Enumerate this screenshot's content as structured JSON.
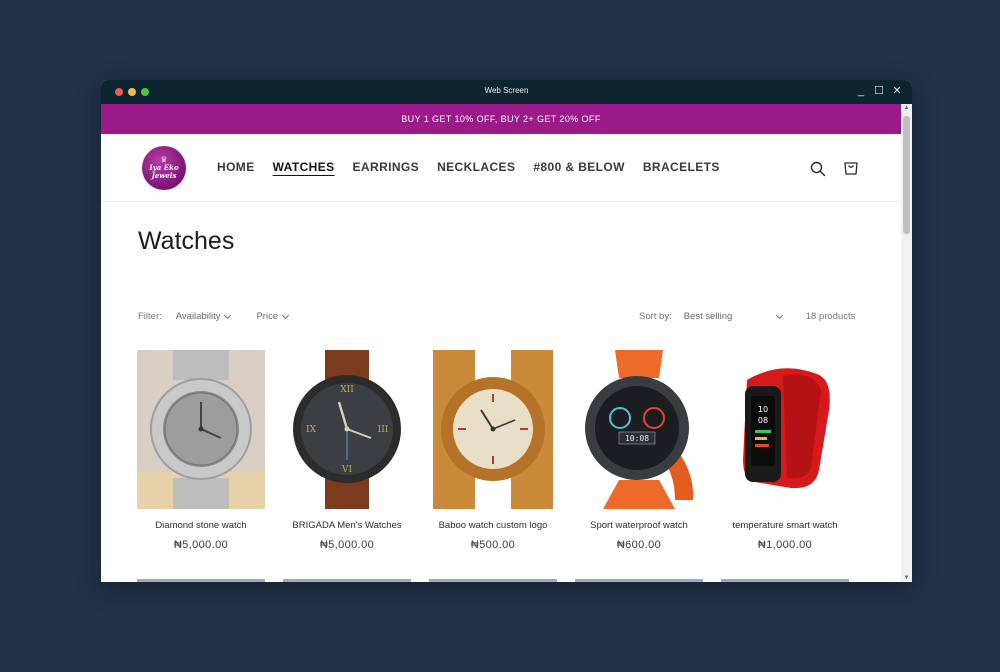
{
  "window": {
    "title": "Web Screen"
  },
  "announcement": {
    "text": "BUY 1 GET 10% OFF, BUY 2+ GET 20% OFF"
  },
  "brand": {
    "logo_text_line1": "Iya Eko",
    "logo_text_line2": "Jewels"
  },
  "nav": {
    "items": [
      {
        "label": "HOME"
      },
      {
        "label": "WATCHES"
      },
      {
        "label": "EARRINGS"
      },
      {
        "label": "NECKLACES"
      },
      {
        "label": "#800 & BELOW"
      },
      {
        "label": "BRACELETS"
      }
    ]
  },
  "collection": {
    "title": "Watches"
  },
  "filters": {
    "label": "Filter:",
    "availability": "Availability",
    "price": "Price"
  },
  "sort": {
    "label": "Sort by:",
    "selected": "Best selling",
    "count": "18 products"
  },
  "products": [
    {
      "title": "Diamond stone watch",
      "price": "₦5,000.00"
    },
    {
      "title": "BRIGADA Men's Watches",
      "price": "₦5,000.00"
    },
    {
      "title": "Baboo watch custom logo",
      "price": "₦500.00"
    },
    {
      "title": "Sport waterproof watch",
      "price": "₦600.00"
    },
    {
      "title": "temperature smart watch",
      "price": "₦1,000.00"
    }
  ],
  "colors": {
    "announcement_bg": "#9b1a8a",
    "titlebar_bg": "#0c2530",
    "desktop_bg": "#213249"
  },
  "icons": [
    "search-icon",
    "cart-icon",
    "chevron-down-icon"
  ]
}
